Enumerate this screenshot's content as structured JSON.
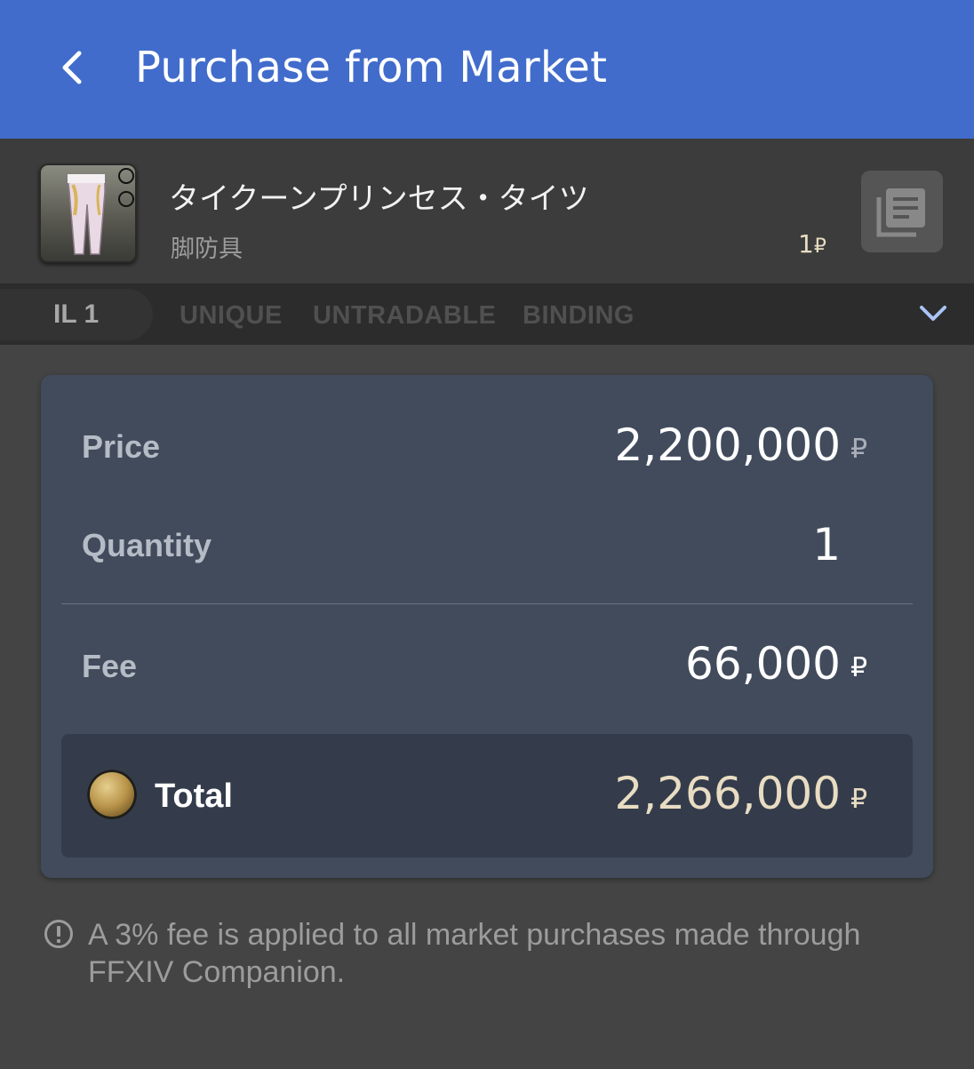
{
  "header": {
    "title": "Purchase from Market",
    "back_icon": "chevron-left-icon"
  },
  "item": {
    "name": "タイクーンプリンセス・タイツ",
    "category": "脚防具",
    "stock": "1",
    "currency_symbol": "₽",
    "doc_icon": "document-icon"
  },
  "tags": {
    "il": "IL 1",
    "unique": "UNIQUE",
    "untradable": "UNTRADABLE",
    "binding": "BINDING",
    "expand_icon": "chevron-down-icon"
  },
  "summary": {
    "price_label": "Price",
    "price_value": "2,200,000",
    "quantity_label": "Quantity",
    "quantity_value": "1",
    "fee_label": "Fee",
    "fee_value": "66,000",
    "total_label": "Total",
    "total_value": "2,266,000",
    "currency_symbol": "₽"
  },
  "notice": {
    "text": "A 3% fee is applied to all market purchases made through FFXIV Companion.",
    "icon": "info-icon"
  },
  "colors": {
    "header_bg": "#416ccb",
    "card_bg": "#414b5c",
    "total_bg": "#343c4b",
    "gold_text": "#e8dcc2"
  }
}
